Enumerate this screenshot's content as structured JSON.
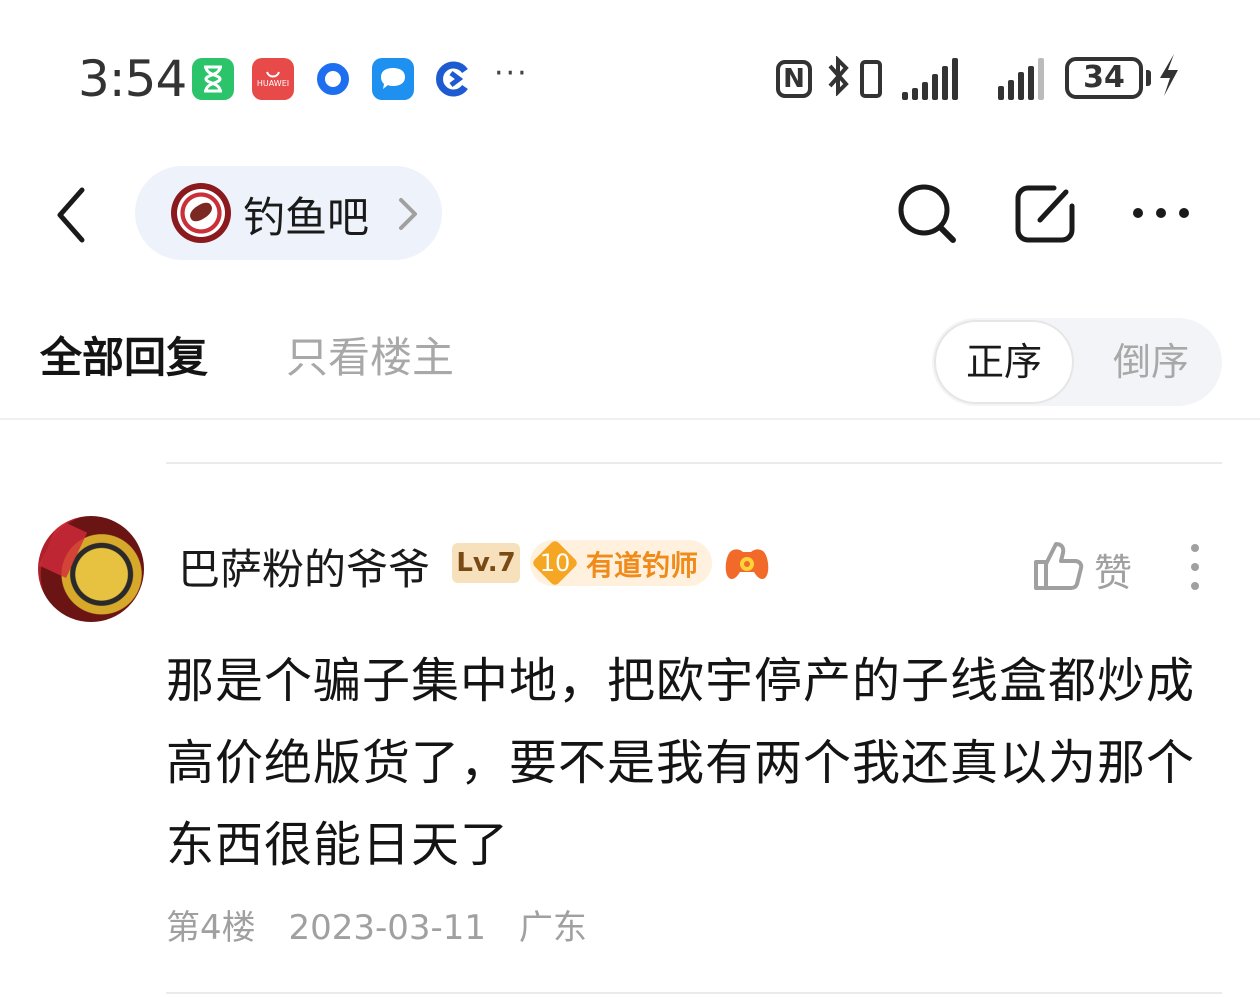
{
  "status_bar": {
    "time": "3:54",
    "app_icons": [
      "hourglass-app-icon",
      "huawei-appgallery-icon",
      "blue-ring-app-icon",
      "message-app-icon",
      "browser-app-icon"
    ],
    "huawei_label": "HUAWEI",
    "more": "···",
    "nfc": "N",
    "battery": "34",
    "colors": {
      "text": "#333333",
      "green": "#2bc46a",
      "red": "#e84a4a",
      "blue": "#1e7ff0"
    }
  },
  "nav": {
    "forum_name": "钓鱼吧",
    "icons": [
      "back-icon",
      "search-icon",
      "edit-icon",
      "more-icon"
    ],
    "pill_color": "#eef2fb"
  },
  "tabs": {
    "all_replies": "全部回复",
    "only_op": "只看楼主",
    "order_asc": "正序",
    "order_desc": "倒序",
    "active_tab": "全部回复",
    "active_order": "正序"
  },
  "reply": {
    "username": "巴萨粉的爷爷",
    "level": "Lv.7",
    "title_level": "10",
    "title_name": "有道钓师",
    "like_label": "赞",
    "content": "那是个骗子集中地，把欧宇停产的子线盒都炒成高价绝版货了，要不是我有两个我还真以为那个东西很能日天了",
    "floor": "第4楼",
    "date": "2023-03-11",
    "location": "广东",
    "colors": {
      "level_bg": "#f7e1bd",
      "title_text": "#f08a1a",
      "meta": "#a0a0a0"
    }
  }
}
